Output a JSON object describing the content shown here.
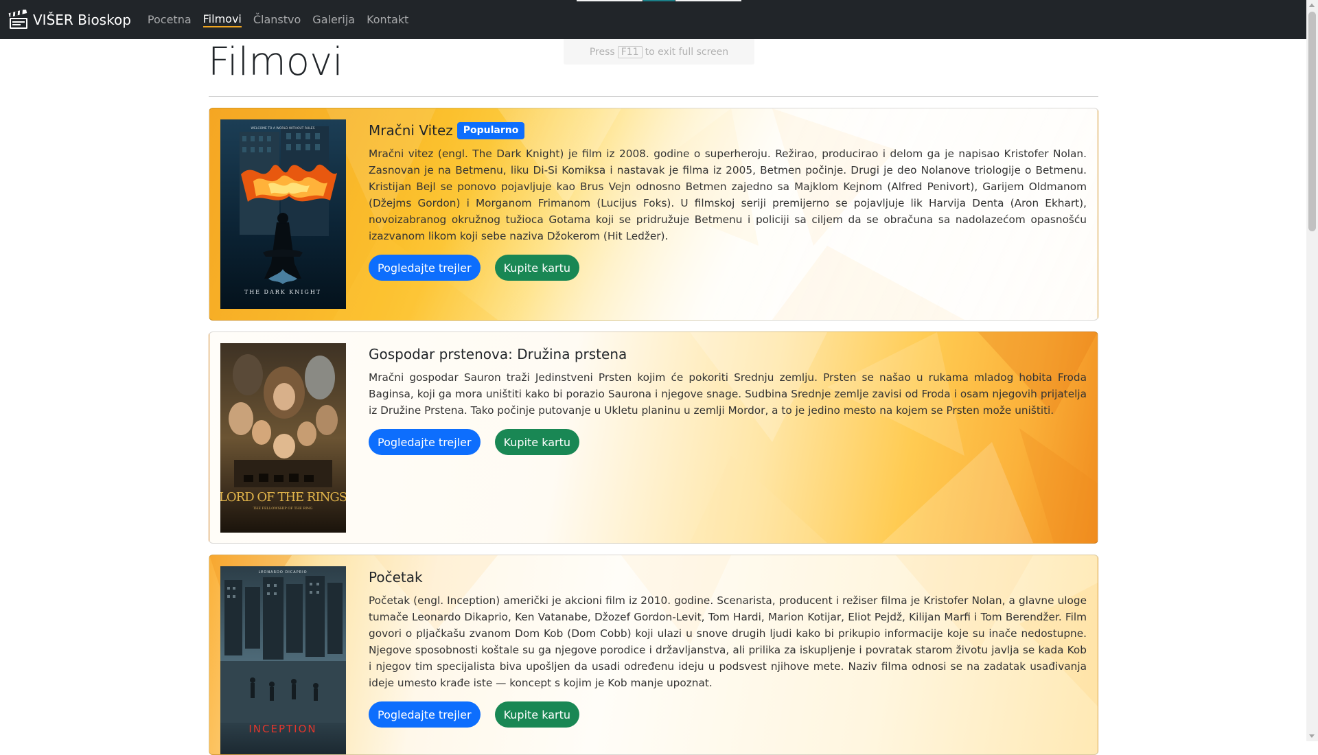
{
  "navbar": {
    "brand": "VIŠER Bioskop",
    "links": [
      {
        "label": "Pocetna",
        "active": false
      },
      {
        "label": "Filmovi",
        "active": true
      },
      {
        "label": "Članstvo",
        "active": false
      },
      {
        "label": "Galerija",
        "active": false
      },
      {
        "label": "Kontakt",
        "active": false
      }
    ]
  },
  "toast": {
    "prefix": "Press",
    "key": "F11",
    "suffix": "to exit full screen"
  },
  "page": {
    "title": "Filmovi"
  },
  "movies": [
    {
      "title": "Mračni Vitez",
      "badge": "Popularno",
      "poster_text": "THE DARK KNIGHT",
      "poster_tagline": "WELCOME TO A WORLD WITHOUT RULES",
      "description": "Mračni vitez (engl. The Dark Knight) je film iz 2008. godine o superheroju. Režirao, producirao i delom ga je napisao Kristofer Nolan. Zasnovan je na Betmenu, liku Di-Si Komiksa i nastavak je filma iz 2005, Betmen počinje. Drugi je deo Nolanove triologije o Betmenu. Kristijan Bejl se ponovo pojavljuje kao Brus Vejn odnosno Betmen zajedno sa Majklom Kejnom (Alfred Penivort), Garijem Oldmanom (Džejms Gordon) i Morganom Frimanom (Lucijus Foks). U filmskoj seriji premijerno se pojavljuje lik Harvija Denta (Aron Ekhart), novoizabranog okružnog tužioca Gotama koji se pridružuje Betmenu i policiji sa ciljem da se obračuna sa nadolazećom opasnošću izazvanom likom koji sebe naziva Džokerom (Hit Ledžer).",
      "trailer_label": "Pogledajte trejler",
      "ticket_label": "Kupite kartu"
    },
    {
      "title": "Gospodar prstenova: Družina prstena",
      "poster_text": "LORD OF THE RINGS",
      "poster_subtitle": "THE FELLOWSHIP OF THE RING",
      "description": "Mračni gospodar Sauron traži Jedinstveni Prsten kojim će pokoriti Srednju zemlju. Prsten se našao u rukama mladog hobita Froda Baginsa, koji ga mora uništiti kako bi porazio Saurona i njegove snage. Sudbina Srednje zemlje zavisi od Froda i osam njegovih prijatelja iz Družine Prstena. Tako počinje putovanje u Ukletu planinu u zemlji Mordor, a to je jedino mesto na kojem se Prsten može uništiti.",
      "trailer_label": "Pogledajte trejler",
      "ticket_label": "Kupite kartu"
    },
    {
      "title": "Početak",
      "poster_text": "INCEPTION",
      "poster_actor": "LEONARDO DICAPRIO",
      "description": "Početak (engl. Inception) američki je akcioni film iz 2010. godine. Scenarista, producent i režiser filma je Kristofer Nolan, a glavne uloge tumače Leonardo Dikaprio, Ken Vatanabe, Džozef Gordon-Levit, Tom Hardi, Marion Kotijar, Eliot Pejdž, Kilijan Marfi i Tom Berendžer. Film govori o pljačkašu zvanom Dom Kob (Dom Cobb) koji ulazi u snove drugih ljudi kako bi prikupio informacije koje su inače nedostupne. Njegove sposobnosti koštale su ga njegove porodice i državljanstva, ali prilika za iskupljenje i povratak starom životu javlja se kada Kob i njegov tim specijalista biva upošljen da usadi određenu ideju u podsvest njihove mete. Naziv filma odnosi se na zadatak usađivanja ideje umesto krađe iste — koncept s kojim je Kob manje upoznat.",
      "trailer_label": "Pogledajte trejler",
      "ticket_label": "Kupite kartu"
    }
  ],
  "colors": {
    "primary": "#0d6efd",
    "success": "#198754",
    "navbar": "#212529",
    "accent": "#f0a520"
  }
}
